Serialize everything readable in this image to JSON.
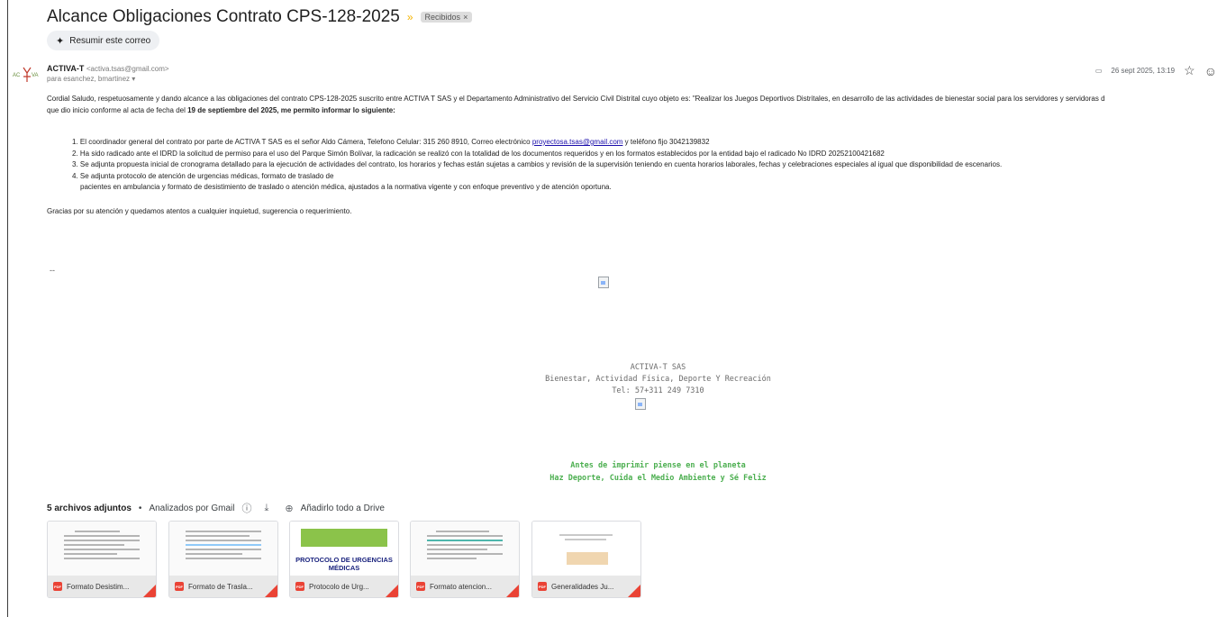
{
  "email": {
    "subject": "Alcance Obligaciones Contrato CPS-128-2025",
    "label_chip": "Recibidos",
    "summarize_label": "Resumir este correo",
    "sender": {
      "name": "ACTIVA-T",
      "email": "<activa.tsas@gmail.com>",
      "recipients": "para esanchez, bmartinez"
    },
    "date": "26 sept 2025, 13:19",
    "body": {
      "para1": "Cordial Saludo, respetuosamente y dando alcance a las obligaciones del contrato CPS-128-2025 suscrito entre ACTIVA T SAS y el Departamento Administrativo del Servicio Civil Distrital cuyo objeto es: \"Realizar los Juegos Deportivos Distritales, en desarrollo de las actividades de bienestar social para los servidores y servidoras d",
      "para2_pre": "que dio inicio conforme al acta de fecha del ",
      "para2_bold": "19 de septiembre del 2025, me permito informar lo siguiente:",
      "item1_pre": "1. El coordinador general del contrato por parte de ACTIVA T SAS  es el señor Aldo Cámera, Telefono Celular: 315 260 8910, Correo electrónico ",
      "item1_link": "proyectosa.tsas@gmail.com",
      "item1_post": " y teléfono fijo 3042139832",
      "item2": "2. Ha sido radicado ante el IDRD  la solicitud de permiso para el uso del Parque Simón Bolívar, la radicación se realizó con la totalidad de los documentos requeridos y en los formatos establecidos por la entidad bajo el radicado No IDRD 20252100421682",
      "item3": "3. Se adjunta propuesta inicial de cronograma detallado para la ejecución de actividades del contrato, los horarios y fechas están sujetas a cambios y revisión de la supervisión teniendo en cuenta horarios laborales, fechas y celebraciones especiales al igual que disponibilidad de escenarios.",
      "item4a": "4. Se adjunta protocolo de atención de urgencias médicas, formato de traslado de",
      "item4b": "pacientes en ambulancia y formato de desistimiento de traslado o atención médica, ajustados a la normativa vigente y con enfoque preventivo y de atención oportuna.",
      "thanks": "Gracias por su atención y quedamos atentos a cualquier inquietud, sugerencia o requerimiento.",
      "dash": "--"
    },
    "signature": {
      "company": "ACTIVA-T SAS",
      "tagline": "Bienestar, Actividad Física,  Deporte Y Recreación",
      "phone": "Tel: 57+311 249 7310",
      "green1": "Antes de imprimir piense en el planeta",
      "green2": "Haz Deporte, Cuida el Medio Ambiente y Sé Feliz"
    }
  },
  "attachments": {
    "header_count": "5 archivos adjuntos",
    "scanned": "Analizados por Gmail",
    "drive_label": "Añadirlo todo a Drive",
    "files": [
      {
        "name": "Formato Desistim..."
      },
      {
        "name": "Formato de Trasla..."
      },
      {
        "name": "Protocolo de Urg...",
        "thumb_text": "PROTOCOLO DE URGENCIAS MÉDICAS"
      },
      {
        "name": "Formato atencion..."
      },
      {
        "name": "Generalidades Ju..."
      }
    ]
  },
  "colors": {
    "link": "#1a0dab",
    "green_text": "#4caf50",
    "pdf_red": "#ea4335"
  },
  "icons": [
    "star-icon",
    "emoji-icon",
    "download-icon",
    "drive-icon",
    "info-icon",
    "pdf-icon",
    "spark-icon"
  ]
}
